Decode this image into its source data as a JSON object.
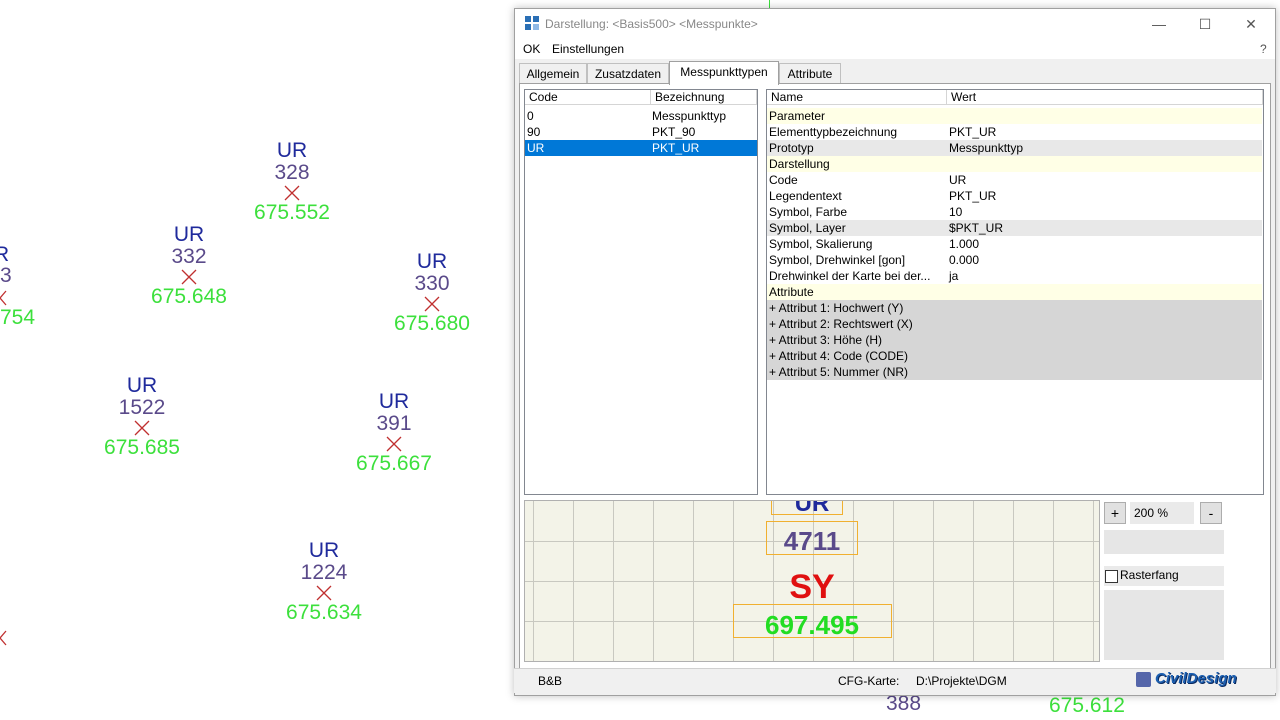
{
  "canvas": {
    "points": [
      {
        "code": "UR",
        "number": "328",
        "elevation": "675.552"
      },
      {
        "code": "UR",
        "number": "332",
        "elevation": "675.648"
      },
      {
        "code": "UR",
        "number": "330",
        "elevation": "675.680"
      },
      {
        "code": "UR",
        "number": "1522",
        "elevation": "675.685"
      },
      {
        "code": "UR",
        "number": "391",
        "elevation": "675.667"
      },
      {
        "code": "UR",
        "number": "1224",
        "elevation": "675.634"
      },
      {
        "code": "R",
        "number": "3",
        "elevation": "754"
      },
      {
        "code": "",
        "number": "388",
        "elevation": ""
      },
      {
        "code": "",
        "number": "",
        "elevation": "675.612"
      }
    ],
    "colors": {
      "code": "#1f2a9c",
      "number": "#5a4a8a",
      "elevation": "#3ce03c",
      "marker": "#c03030"
    }
  },
  "dialog": {
    "title": "Darstellung: <Basis500> <Messpunkte>",
    "icon": "app-icon",
    "window_buttons": {
      "minimize": "—",
      "maximize": "☐",
      "close": "✕"
    },
    "menu": {
      "ok": "OK",
      "settings": "Einstellungen",
      "help": "?"
    },
    "tabs": [
      "Allgemein",
      "Zusatzdaten",
      "Messpunkttypen",
      "Attribute"
    ],
    "active_tab": "Messpunkttypen",
    "type_list": {
      "headers": {
        "code": "Code",
        "name": "Bezeichnung"
      },
      "rows": [
        {
          "code": "0",
          "name": "Messpunkttyp"
        },
        {
          "code": "90",
          "name": "PKT_90"
        },
        {
          "code": "UR",
          "name": "PKT_UR"
        }
      ],
      "selected": "UR"
    },
    "properties": {
      "headers": {
        "name": "Name",
        "value": "Wert"
      },
      "rows": [
        {
          "name": "Parameter",
          "value": "",
          "kind": "cat"
        },
        {
          "name": "Elementtypbezeichnung",
          "value": "PKT_UR",
          "kind": ""
        },
        {
          "name": "Prototyp",
          "value": "Messpunkttyp",
          "kind": "grey"
        },
        {
          "name": "Darstellung",
          "value": "",
          "kind": "cat"
        },
        {
          "name": "Code",
          "value": "UR",
          "kind": ""
        },
        {
          "name": "Legendentext",
          "value": "PKT_UR",
          "kind": ""
        },
        {
          "name": "Symbol, Farbe",
          "value": "10",
          "kind": ""
        },
        {
          "name": "Symbol, Layer",
          "value": "$PKT_UR",
          "kind": "grey"
        },
        {
          "name": "Symbol, Skalierung",
          "value": "1.000",
          "kind": ""
        },
        {
          "name": "Symbol, Drehwinkel [gon]",
          "value": "0.000",
          "kind": ""
        },
        {
          "name": "Drehwinkel der Karte bei der...",
          "value": "ja",
          "kind": ""
        },
        {
          "name": "Attribute",
          "value": "",
          "kind": "cat"
        },
        {
          "name": "+ Attribut 1: Hochwert (Y)",
          "value": "",
          "kind": "attr"
        },
        {
          "name": "+ Attribut 2: Rechtswert (X)",
          "value": "",
          "kind": "attr"
        },
        {
          "name": "+ Attribut 3: Höhe (H)",
          "value": "",
          "kind": "attr"
        },
        {
          "name": "+ Attribut 4: Code (CODE)",
          "value": "",
          "kind": "attr"
        },
        {
          "name": "+ Attribut 5: Nummer (NR)",
          "value": "",
          "kind": "attr"
        }
      ]
    },
    "preview": {
      "code": "UR",
      "number": "4711",
      "symbol": "SY",
      "elevation": "697.495",
      "colors": {
        "code": "#1f2a9c",
        "number": "#5a4a8a",
        "symbol": "#e01010",
        "elevation": "#22dd22"
      }
    },
    "zoom": {
      "plus": "+",
      "value": "200 %",
      "minus": "-"
    },
    "rasterfang": {
      "label": "Rasterfang",
      "checked": false
    },
    "status": {
      "left": "B&B",
      "cfg_label": "CFG-Karte:",
      "cfg_path": "D:\\Projekte\\DGM",
      "logo": "CivilDesign"
    }
  }
}
